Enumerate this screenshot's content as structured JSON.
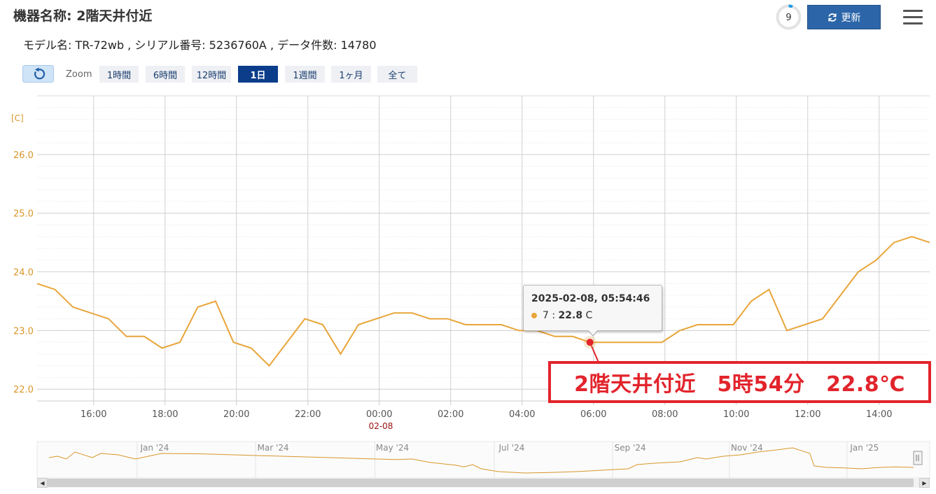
{
  "header": {
    "title": "機器名称: 2階天井付近",
    "subtitle": "モデル名: TR-72wb , シリアル番号: 5236760A , データ件数: 14780",
    "countdown": "9",
    "refresh_label": "更新",
    "refresh_icon": "refresh-icon",
    "menu_icon": "hamburger-menu-icon"
  },
  "zoom": {
    "label": "Zoom",
    "reset_icon": "reset-zoom-icon",
    "buttons": [
      "1時間",
      "6時間",
      "12時間",
      "1日",
      "1週間",
      "1ヶ月",
      "全て"
    ],
    "active": "1日"
  },
  "chart_data": {
    "type": "line",
    "ylabel": "[C]",
    "ylim": [
      21.8,
      27.0
    ],
    "y_ticks": [
      "22.0",
      "23.0",
      "24.0",
      "25.0",
      "26.0"
    ],
    "xlim": [
      "2025-02-07T14:25",
      "2025-02-08T15:25"
    ],
    "x_ticks": [
      "16:00",
      "18:00",
      "20:00",
      "22:00",
      "00:00",
      "02:00",
      "04:00",
      "06:00",
      "08:00",
      "10:00",
      "12:00",
      "14:00"
    ],
    "date_label": "02-08",
    "line_color": "#e8a53a",
    "grid": true,
    "series": [
      {
        "name": "7",
        "x": [
          "2025-02-07T14:25",
          "2025-02-07T14:55",
          "2025-02-07T15:25",
          "2025-02-07T16:25",
          "2025-02-07T16:55",
          "2025-02-07T17:25",
          "2025-02-07T17:55",
          "2025-02-07T18:25",
          "2025-02-07T18:55",
          "2025-02-07T19:25",
          "2025-02-07T19:55",
          "2025-02-07T20:25",
          "2025-02-07T20:55",
          "2025-02-07T21:55",
          "2025-02-07T22:25",
          "2025-02-07T22:55",
          "2025-02-07T23:25",
          "2025-02-08T00:25",
          "2025-02-08T00:55",
          "2025-02-08T01:25",
          "2025-02-08T01:55",
          "2025-02-08T02:25",
          "2025-02-08T03:25",
          "2025-02-08T03:55",
          "2025-02-08T04:25",
          "2025-02-08T04:55",
          "2025-02-08T05:25",
          "2025-02-08T05:54",
          "2025-02-08T06:25",
          "2025-02-08T07:55",
          "2025-02-08T08:25",
          "2025-02-08T08:55",
          "2025-02-08T09:55",
          "2025-02-08T10:25",
          "2025-02-08T10:55",
          "2025-02-08T11:25",
          "2025-02-08T12:25",
          "2025-02-08T13:25",
          "2025-02-08T13:55",
          "2025-02-08T14:25",
          "2025-02-08T14:55",
          "2025-02-08T15:25"
        ],
        "y": [
          23.8,
          23.7,
          23.4,
          23.2,
          22.9,
          22.9,
          22.7,
          22.8,
          23.4,
          23.5,
          22.8,
          22.7,
          22.4,
          23.2,
          23.1,
          22.6,
          23.1,
          23.3,
          23.3,
          23.2,
          23.2,
          23.1,
          23.1,
          23.0,
          23.0,
          22.9,
          22.9,
          22.8,
          22.8,
          22.8,
          23.0,
          23.1,
          23.1,
          23.5,
          23.7,
          23.0,
          23.2,
          24.0,
          24.2,
          24.5,
          24.6,
          24.5
        ]
      }
    ],
    "tooltip": {
      "time": "2025-02-08, 05:54:46",
      "series": "7",
      "value": "22.8",
      "unit": "C"
    },
    "annotation": "2階天井付近　5時54分　22.8℃",
    "navigator": {
      "x_ticks": [
        "Jan '24",
        "Mar '24",
        "May '24",
        "Jul '24",
        "Sep '24",
        "Nov '24",
        "Jan '25"
      ],
      "points": [
        [
          0,
          0.55
        ],
        [
          1,
          0.6
        ],
        [
          2,
          0.5
        ],
        [
          3,
          0.75
        ],
        [
          5,
          0.55
        ],
        [
          6,
          0.7
        ],
        [
          8,
          0.65
        ],
        [
          10,
          0.5
        ],
        [
          13,
          0.7
        ],
        [
          18,
          0.68
        ],
        [
          40,
          0.48
        ],
        [
          42,
          0.5
        ],
        [
          44,
          0.38
        ],
        [
          47,
          0.28
        ],
        [
          48,
          0.22
        ],
        [
          49,
          0.3
        ],
        [
          50,
          0.15
        ],
        [
          52,
          0.05
        ],
        [
          55,
          0.0
        ],
        [
          58,
          0.02
        ],
        [
          61,
          0.05
        ],
        [
          64,
          0.1
        ],
        [
          67,
          0.15
        ],
        [
          68,
          0.3
        ],
        [
          70,
          0.35
        ],
        [
          73,
          0.4
        ],
        [
          75,
          0.55
        ],
        [
          76,
          0.5
        ],
        [
          78,
          0.6
        ],
        [
          80,
          0.65
        ],
        [
          82,
          0.75
        ],
        [
          84,
          0.82
        ],
        [
          86,
          0.9
        ],
        [
          88,
          0.7
        ],
        [
          88.5,
          0.25
        ],
        [
          90,
          0.2
        ],
        [
          92,
          0.18
        ],
        [
          94,
          0.15
        ],
        [
          96,
          0.2
        ],
        [
          98,
          0.22
        ],
        [
          100,
          0.2
        ]
      ]
    }
  }
}
